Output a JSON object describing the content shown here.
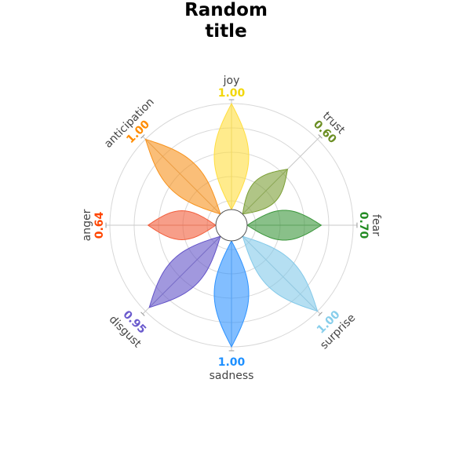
{
  "chart_data": {
    "type": "plutchik-wheel",
    "title": "Random title",
    "categories": [
      "joy",
      "trust",
      "fear",
      "surprise",
      "sadness",
      "disgust",
      "anger",
      "anticipation"
    ],
    "values": [
      1.0,
      0.6,
      0.7,
      1.0,
      1.0,
      0.95,
      0.64,
      1.0
    ],
    "value_labels": [
      "1.00",
      "0.60",
      "0.70",
      "1.00",
      "1.00",
      "0.95",
      "0.64",
      "1.00"
    ],
    "colors": [
      "#ffde40",
      "#7b9f35",
      "#3b963b",
      "#84c9e9",
      "#2f93ff",
      "#6353c8",
      "#f25d3b",
      "#f7931e"
    ],
    "label_colors": [
      "#f2d70a",
      "#6b8e23",
      "#228b22",
      "#87ceeb",
      "#1e90ff",
      "#6a5acd",
      "#ff4500",
      "#ff8c00"
    ],
    "rlim": [
      0,
      1
    ],
    "grid": true
  }
}
